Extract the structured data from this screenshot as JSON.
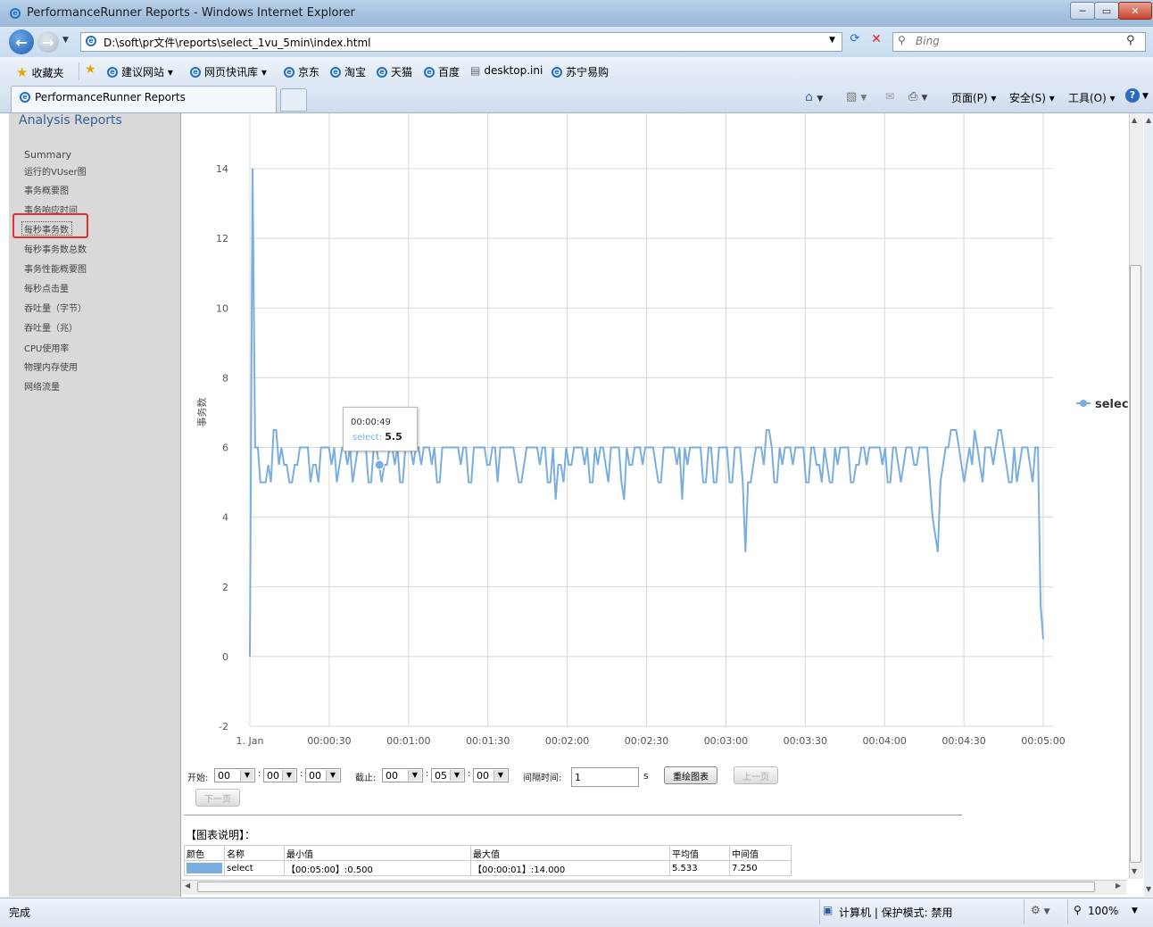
{
  "window": {
    "title": "PerformanceRunner Reports - Windows Internet Explorer"
  },
  "nav": {
    "address": "D:\\soft\\pr文件\\reports\\select_1vu_5min\\index.html",
    "search_placeholder": "Bing"
  },
  "favorites": {
    "label": "收藏夹",
    "items": [
      "建议网站 ▾",
      "网页快讯库 ▾",
      "京东",
      "淘宝",
      "天猫",
      "百度",
      "desktop.ini",
      "苏宁易购"
    ]
  },
  "tab": {
    "label": "PerformanceRunner Reports"
  },
  "toolbar": {
    "page": "页面(P) ▾",
    "safety": "安全(S) ▾",
    "tools": "工具(O) ▾"
  },
  "sidebar": {
    "title": "Analysis Reports",
    "items": [
      "Summary",
      "运行的VUser图",
      "事务概要图",
      "事务响应时间",
      "每秒事务数",
      "每秒事务数总数",
      "事务性能概要图",
      "每秒点击量",
      "吞吐量（字节）",
      "吞吐量（兆）",
      "CPU使用率",
      "物理内存使用",
      "网络流量"
    ]
  },
  "chart_data": {
    "type": "line",
    "ylabel": "事务数",
    "xlabel": "",
    "ylim": [
      -2,
      14
    ],
    "y_ticks": [
      "14",
      "12",
      "10",
      "8",
      "6",
      "4",
      "2",
      "0",
      "-2"
    ],
    "x_ticks": [
      "1. Jan",
      "00:00:30",
      "00:01:00",
      "00:01:30",
      "00:02:00",
      "00:02:30",
      "00:03:00",
      "00:03:30",
      "00:04:00",
      "00:04:30",
      "00:05:00"
    ],
    "xlim_seconds": [
      0,
      300
    ],
    "series": [
      {
        "name": "selec",
        "color": "#7aaee0",
        "values": [
          0,
          14,
          6,
          6,
          5,
          5,
          5,
          5.5,
          5,
          6.5,
          6.5,
          5.5,
          6,
          5.5,
          5.5,
          5,
          5,
          5.5,
          5.5,
          6,
          6,
          6,
          6,
          5,
          5.5,
          5.5,
          5,
          6,
          6,
          6,
          6,
          5.5,
          6,
          5,
          5.5,
          6,
          6,
          5.5,
          6,
          5,
          5.5,
          6,
          6,
          6,
          6,
          5,
          5,
          6,
          6,
          5.5,
          5,
          5.5,
          5.5,
          6,
          6,
          5.5,
          6,
          5,
          5,
          6,
          6,
          6,
          5.5,
          6,
          6,
          5.5,
          6,
          6,
          6,
          5.5,
          6,
          5,
          5,
          6,
          6,
          6,
          6,
          6,
          6,
          6,
          5.5,
          6,
          6,
          5,
          5,
          6,
          6,
          6,
          6,
          6,
          5.5,
          5.5,
          6,
          6,
          5,
          6,
          6,
          6,
          6,
          6,
          6,
          5.5,
          5,
          5,
          5.5,
          6,
          6,
          6,
          6,
          6,
          5.5,
          6,
          6,
          5,
          5,
          6,
          4.5,
          5.5,
          5.5,
          5,
          6,
          5.5,
          5.5,
          6,
          6,
          6,
          6,
          5.5,
          6,
          5,
          5,
          6,
          5.5,
          6,
          6,
          5.5,
          5,
          6,
          6,
          6,
          6,
          5,
          4.5,
          6,
          5.5,
          5.5,
          6,
          6,
          6,
          5.5,
          6,
          6,
          6,
          6,
          5.5,
          5,
          5,
          6,
          6,
          6,
          6,
          6,
          5.5,
          6,
          4.5,
          6,
          5.5,
          6,
          6,
          6,
          6,
          6,
          5,
          5,
          6,
          6,
          5,
          5,
          6,
          6,
          6,
          6,
          5,
          5,
          6,
          6,
          6,
          5,
          3,
          5,
          5,
          5.5,
          6,
          6,
          6,
          5.5,
          6.5,
          6.5,
          6,
          5,
          5,
          6,
          5.5,
          6,
          6,
          6,
          5.5,
          6,
          6,
          6,
          6,
          5,
          5,
          6,
          6,
          5.5,
          5.5,
          5,
          6,
          5.5,
          5,
          5,
          6,
          5.5,
          6,
          6,
          6,
          6,
          5,
          5,
          5.5,
          5.5,
          6,
          6,
          5.5,
          6,
          6,
          6,
          6,
          6,
          5.5,
          6,
          5,
          5,
          6,
          6,
          5.5,
          5,
          5.5,
          6,
          6,
          6,
          5.5,
          5.5,
          6,
          6,
          6,
          6,
          5,
          4,
          3.5,
          3,
          5,
          5.5,
          6,
          6,
          6.5,
          6.5,
          6.5,
          6,
          5.5,
          5,
          5.5,
          6,
          5.5,
          6.5,
          6,
          5.5,
          5,
          6,
          6,
          6,
          5.5,
          6,
          6.5,
          6.5,
          6,
          5.5,
          5,
          5,
          6,
          5,
          5.5,
          6,
          6,
          6,
          5.5,
          5,
          6,
          6,
          1.5,
          0.5
        ]
      }
    ],
    "tooltip": {
      "time": "00:00:49",
      "series": "select:",
      "value": "5.5"
    },
    "legend": "selec"
  },
  "controls": {
    "start_label": "开始:",
    "start": [
      "00",
      "00",
      "00"
    ],
    "end_label": "截止:",
    "end": [
      "00",
      "05",
      "00"
    ],
    "interval_label": "间隔时间:",
    "interval_value": "1",
    "interval_unit": "s",
    "redraw": "重绘图表",
    "prev": "上一页",
    "next": "下一页",
    "colon": ":"
  },
  "legend_table": {
    "title": "【图表说明】：",
    "headers": [
      "颜色",
      "名称",
      "最小值",
      "最大值",
      "平均值",
      "中间值"
    ],
    "row": {
      "color": "#7aaee0",
      "name": "select",
      "min": "【00:05:00】:0.500",
      "max": "【00:00:01】:14.000",
      "avg": "5.533",
      "median": "7.250"
    }
  },
  "status": {
    "left": "完成",
    "zone": "计算机 | 保护模式: 禁用",
    "zoom": "100%"
  }
}
